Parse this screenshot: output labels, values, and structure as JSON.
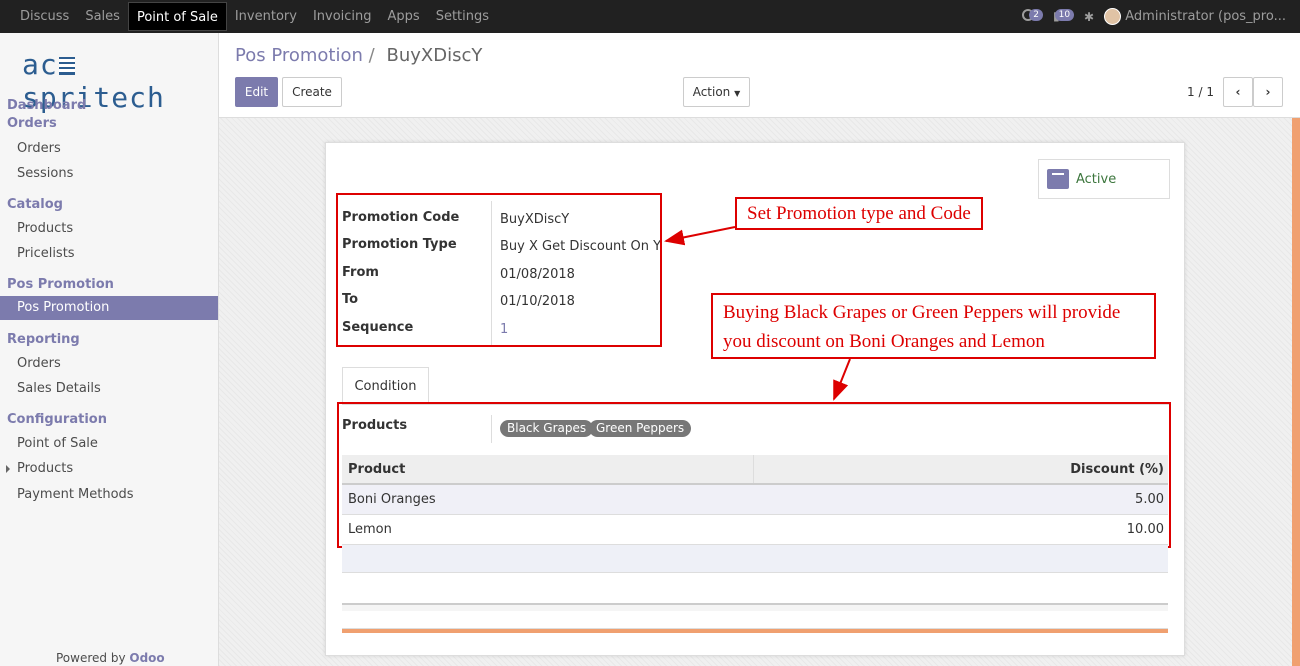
{
  "topbar": {
    "menus": [
      "Discuss",
      "Sales",
      "Point of Sale",
      "Inventory",
      "Invoicing",
      "Apps",
      "Settings"
    ],
    "active": "Point of Sale",
    "clock_badge": "2",
    "chat_badge": "10",
    "user": "Administrator (pos_pro..."
  },
  "sidebar": {
    "logo": "acspritech",
    "dashboard": "Dashboard",
    "sections": [
      {
        "title": "Orders",
        "items": [
          "Orders",
          "Sessions"
        ]
      },
      {
        "title": "Catalog",
        "items": [
          "Products",
          "Pricelists"
        ]
      },
      {
        "title": "Pos Promotion",
        "items": [
          "Pos Promotion"
        ]
      },
      {
        "title": "Reporting",
        "items": [
          "Orders",
          "Sales Details"
        ]
      },
      {
        "title": "Configuration",
        "items": [
          "Point of Sale",
          "Products",
          "Payment Methods"
        ]
      }
    ],
    "powered": "Powered by",
    "brand": "Odoo"
  },
  "header": {
    "breadcrumb_parent": "Pos Promotion",
    "breadcrumb_sep": "/",
    "breadcrumb_current": "BuyXDiscY",
    "edit": "Edit",
    "create": "Create",
    "action": "Action",
    "pager": "1 / 1"
  },
  "form": {
    "status": "Active",
    "fields": [
      {
        "label": "Promotion Code",
        "value": "BuyXDiscY"
      },
      {
        "label": "Promotion Type",
        "value": "Buy X Get Discount On Y"
      },
      {
        "label": "From",
        "value": "01/08/2018"
      },
      {
        "label": "To",
        "value": "01/10/2018"
      },
      {
        "label": "Sequence",
        "value": "1"
      }
    ],
    "tab": "Condition",
    "products_label": "Products",
    "products": [
      "Black Grapes",
      "Green Peppers"
    ],
    "table": {
      "headers": [
        "Product",
        "Discount (%)"
      ],
      "rows": [
        {
          "product": "Boni Oranges",
          "discount": "5.00"
        },
        {
          "product": "Lemon",
          "discount": "10.00"
        }
      ]
    }
  },
  "annotations": {
    "callout1": "Set Promotion type and Code",
    "callout2_line1": "Buying Black Grapes or Green Peppers will provide",
    "callout2_line2": "you discount on Boni Oranges and Lemon"
  },
  "colors": {
    "accent": "#7c7bad",
    "annotation": "#dd0000",
    "active_status": "#3c763d"
  }
}
